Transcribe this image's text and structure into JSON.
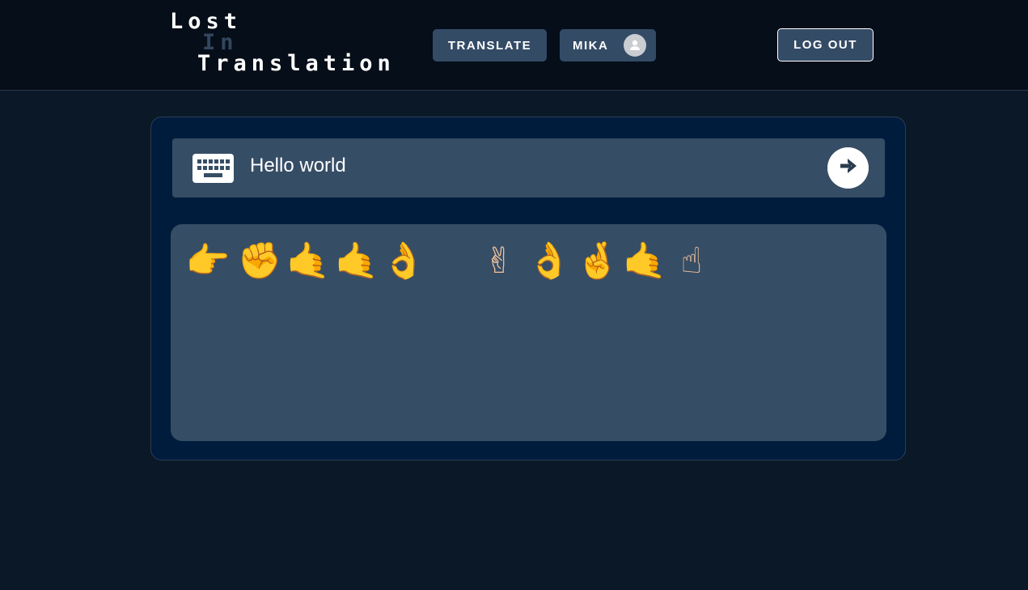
{
  "logo": {
    "line1": "Lost",
    "line2": "In",
    "line3": "Translation"
  },
  "nav": {
    "translate_label": "TRANSLATE",
    "user_label": "MIKA",
    "logout_label": "LOG OUT"
  },
  "input": {
    "value": "Hello world",
    "icon": "keyboard-icon"
  },
  "submit": {
    "icon": "arrow-right-icon"
  },
  "output": {
    "signs": [
      {
        "letter": "h",
        "glyph": "👉"
      },
      {
        "letter": "e",
        "glyph": "✊"
      },
      {
        "letter": "l",
        "glyph": "🤙"
      },
      {
        "letter": "l",
        "glyph": "🤙"
      },
      {
        "letter": "o",
        "glyph": "👌"
      },
      {
        "letter": " ",
        "glyph": ""
      },
      {
        "letter": "w",
        "glyph": "✌"
      },
      {
        "letter": "o",
        "glyph": "👌"
      },
      {
        "letter": "r",
        "glyph": "🤞"
      },
      {
        "letter": "l",
        "glyph": "🤙"
      },
      {
        "letter": "d",
        "glyph": "☝"
      }
    ]
  },
  "colors": {
    "background": "#0a1828",
    "header": "#050e19",
    "button": "#344b66",
    "panel": "#001c3d",
    "inner": "#364d66",
    "logo_in": "#33465f"
  }
}
